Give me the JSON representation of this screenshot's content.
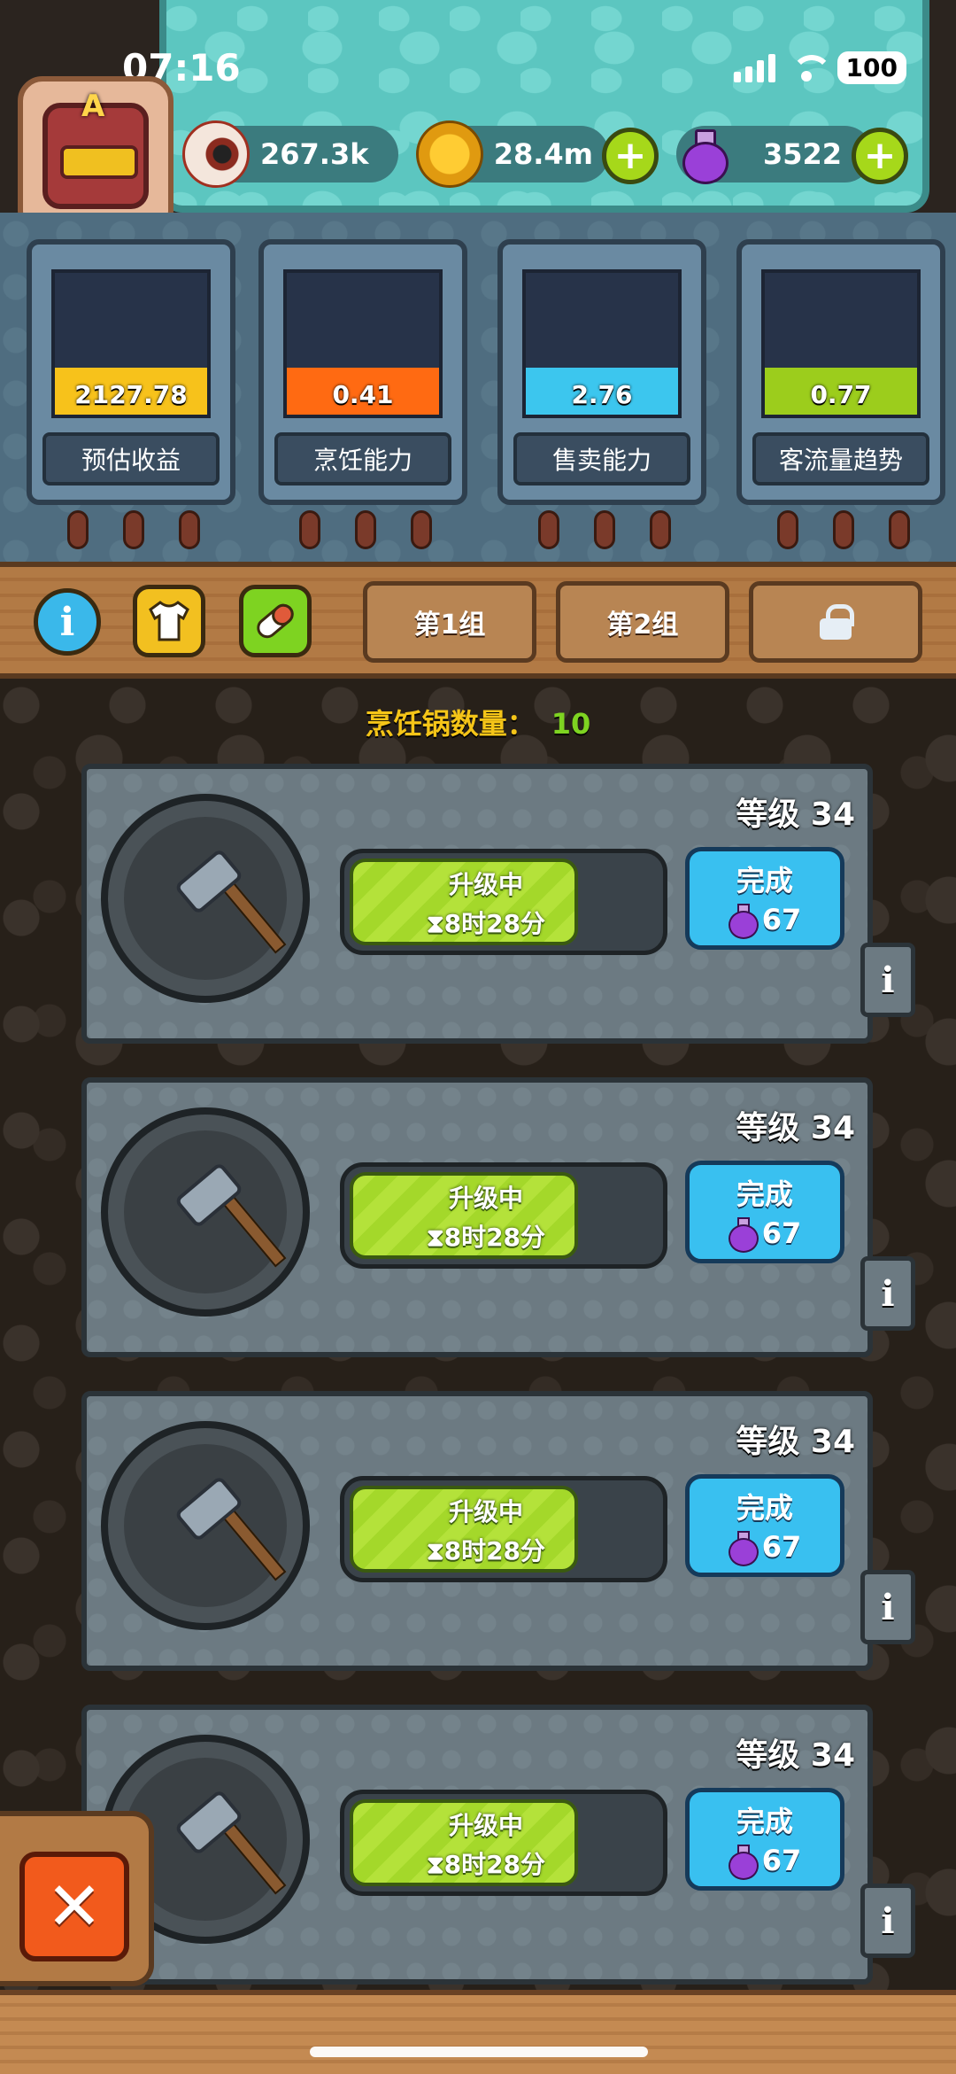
{
  "status_bar": {
    "time": "07:16",
    "battery": "100"
  },
  "avatar": {
    "letter": "A"
  },
  "resources": {
    "eyes": "267.3k",
    "coins": "28.4m",
    "potions": "3522",
    "plus_label": "+"
  },
  "stats": [
    {
      "value": "2127.78",
      "label": "预估收益",
      "color": "#f7c21b",
      "fill_fraction": 0.33
    },
    {
      "value": "0.41",
      "label": "烹饪能力",
      "color": "#ff6a12",
      "fill_fraction": 0.33
    },
    {
      "value": "2.76",
      "label": "售卖能力",
      "color": "#3cc6ee",
      "fill_fraction": 0.33
    },
    {
      "value": "0.77",
      "label": "客流量趋势",
      "color": "#9ccd1c",
      "fill_fraction": 0.33
    }
  ],
  "toolbar": {
    "info_label": "i",
    "tab_group1": "第1组",
    "tab_group2": "第2组"
  },
  "pot_count": {
    "label": "烹饪锅数量：",
    "value": "10"
  },
  "pots": [
    {
      "level": "等级 34",
      "status": "升级中",
      "timer": "⧗8时28分",
      "progress_fraction": 0.75,
      "done_label": "完成",
      "cost": "67",
      "info_label": "i"
    },
    {
      "level": "等级 34",
      "status": "升级中",
      "timer": "⧗8时28分",
      "progress_fraction": 0.75,
      "done_label": "完成",
      "cost": "67",
      "info_label": "i"
    },
    {
      "level": "等级 34",
      "status": "升级中",
      "timer": "⧗8时28分",
      "progress_fraction": 0.75,
      "done_label": "完成",
      "cost": "67",
      "info_label": "i"
    },
    {
      "level": "等级 34",
      "status": "升级中",
      "timer": "⧗8时28分",
      "progress_fraction": 0.75,
      "done_label": "完成",
      "cost": "67",
      "info_label": "i"
    }
  ],
  "close_label": "✕"
}
